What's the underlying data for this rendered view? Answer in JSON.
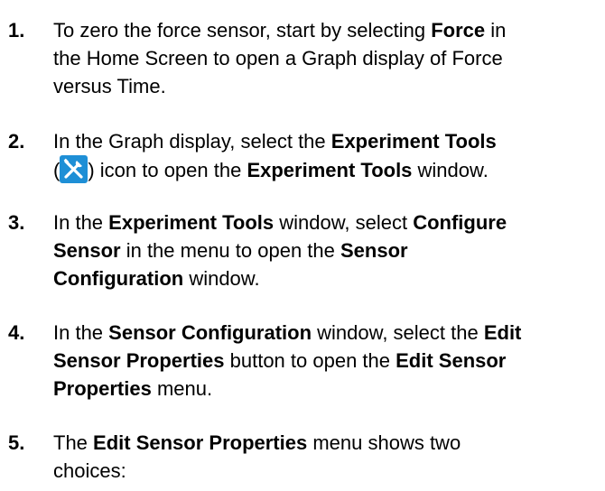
{
  "steps": [
    {
      "number": "1.",
      "lines": [
        [
          "To zero the force sensor, start by selecting ",
          {
            "b": "Force"
          },
          " in"
        ],
        [
          "the Home Screen to open a Graph display of Force"
        ],
        [
          "versus Time."
        ]
      ]
    },
    {
      "number": "2.",
      "lines": [
        [
          "In the Graph display, select the ",
          {
            "b": "Experiment Tools"
          }
        ],
        [
          "(",
          {
            "icon": "experiment-tools-icon"
          },
          ") icon to open the ",
          {
            "b": "Experiment Tools"
          },
          " window."
        ]
      ]
    },
    {
      "number": "3.",
      "lines": [
        [
          "In the ",
          {
            "b": "Experiment Tools"
          },
          " window, select ",
          {
            "b": "Configure"
          }
        ],
        [
          {
            "b": "Sensor"
          },
          " in the menu to open the ",
          {
            "b": "Sensor"
          }
        ],
        [
          {
            "b": "Configuration"
          },
          " window."
        ]
      ]
    },
    {
      "number": "4.",
      "lines": [
        [
          "In the ",
          {
            "b": "Sensor Configuration"
          },
          " window, select the ",
          {
            "b": "Edit"
          }
        ],
        [
          {
            "b": "Sensor Properties"
          },
          " button to open the ",
          {
            "b": "Edit Sensor"
          }
        ],
        [
          {
            "b": "Properties"
          },
          " menu."
        ]
      ]
    },
    {
      "number": "5.",
      "lines": [
        [
          "The ",
          {
            "b": "Edit Sensor Properties"
          },
          " menu shows two"
        ],
        [
          "choices:"
        ]
      ]
    }
  ],
  "colors": {
    "icon_bg": "#1e8fd6"
  }
}
